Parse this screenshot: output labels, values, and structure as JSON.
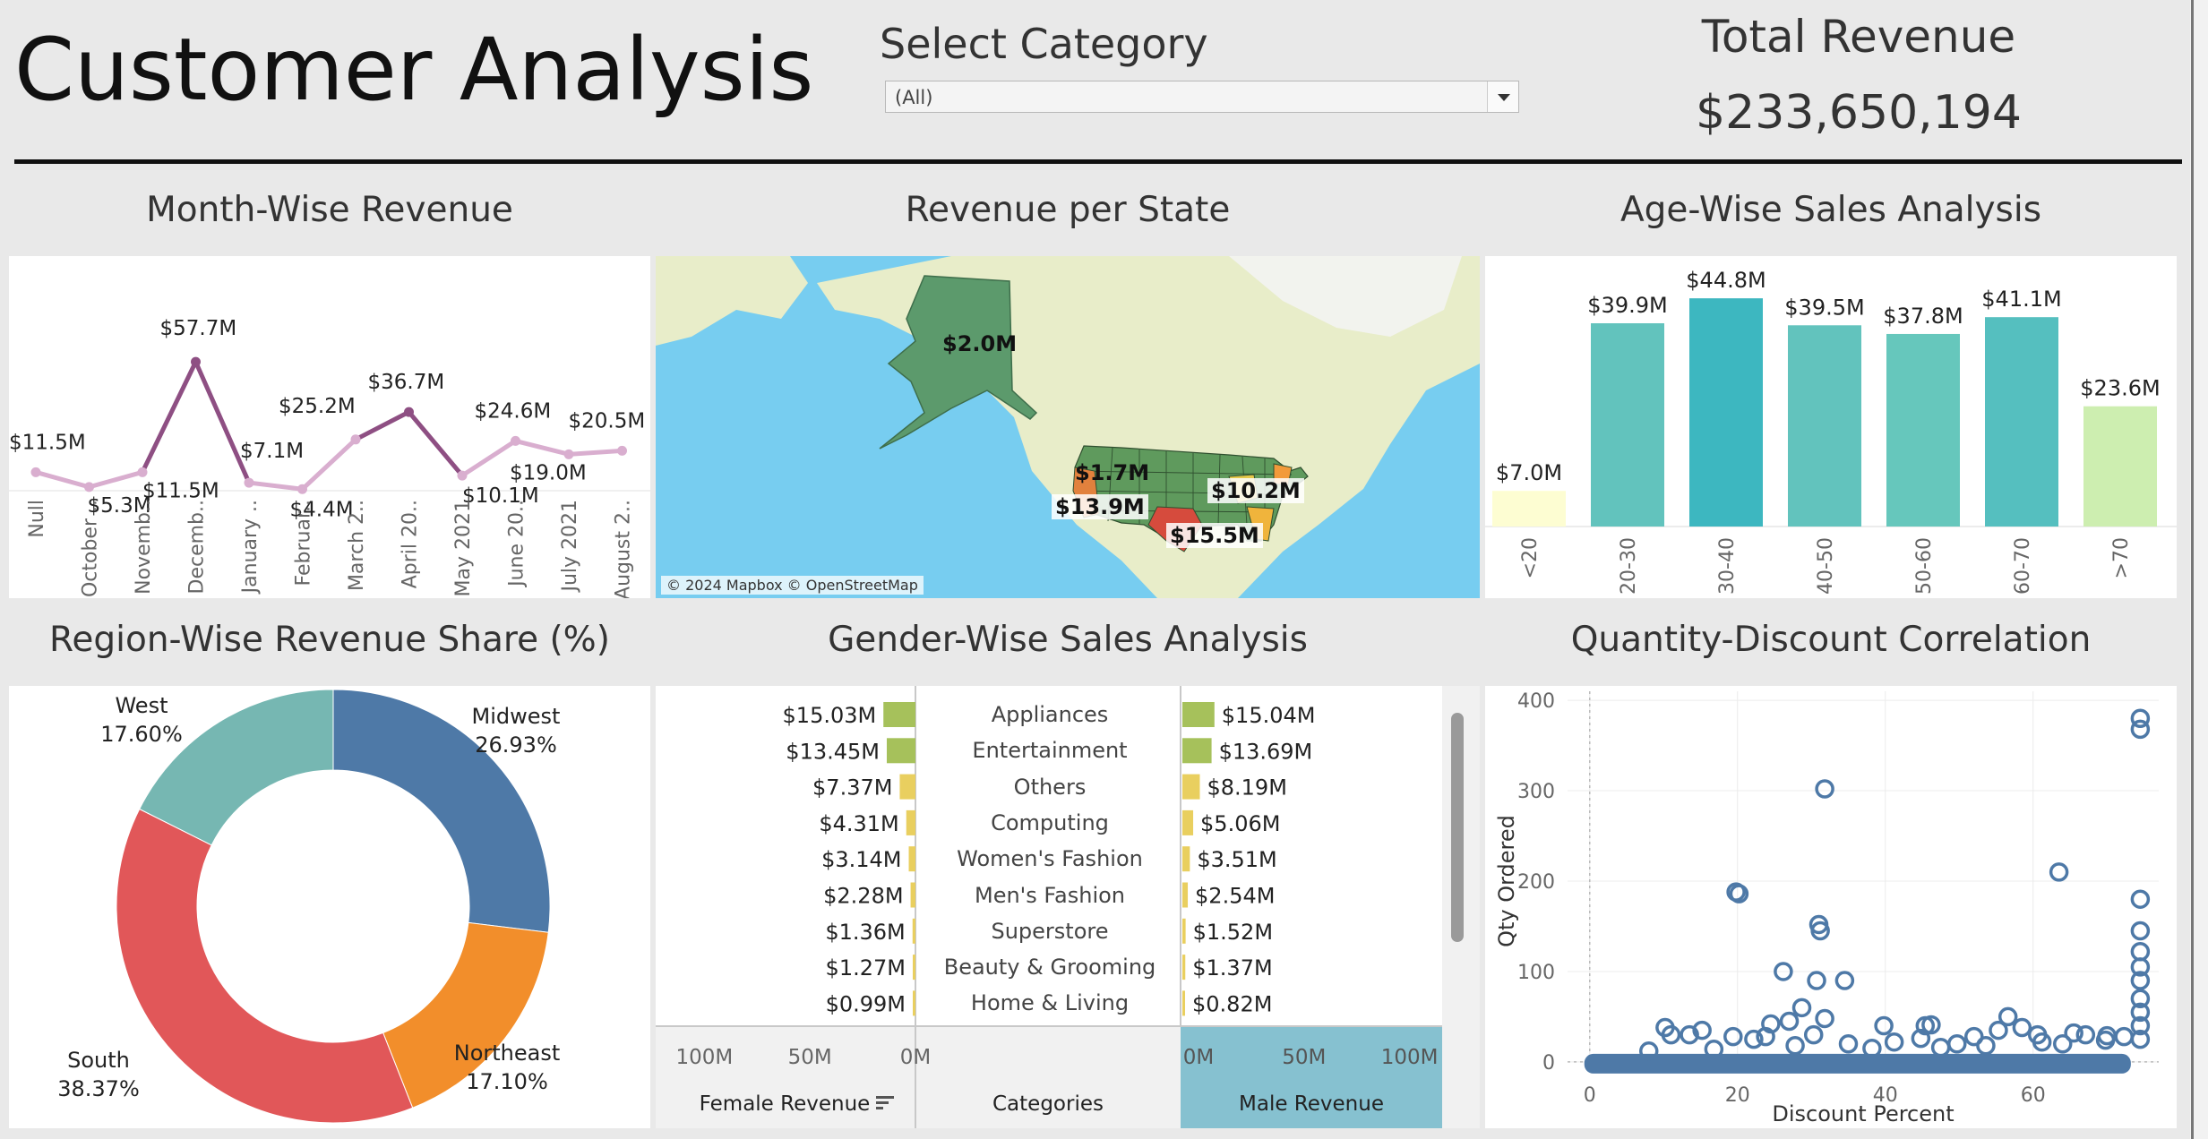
{
  "header": {
    "title": "Customer Analysis",
    "select_label": "Select Category",
    "select_value": "(All)",
    "revenue_label": "Total Revenue",
    "revenue_value": "$233,650,194"
  },
  "titles": {
    "month": "Month-Wise Revenue",
    "map": "Revenue per State",
    "age": "Age-Wise Sales Analysis",
    "region": "Region-Wise Revenue Share (%)",
    "gender": "Gender-Wise Sales Analysis",
    "scatter": "Quantity-Discount Correlation"
  },
  "map": {
    "credit": "© 2024 Mapbox © OpenStreetMap",
    "labels": [
      "$2.0M",
      "$1.7M",
      "$13.9M",
      "$15.5M",
      "$10.2M"
    ]
  },
  "chart_data": [
    {
      "id": "month",
      "type": "line",
      "title": "Month-Wise Revenue",
      "categories": [
        "Null",
        "October ..",
        "Novemb..",
        "Decemb..",
        "January ..",
        "Februar..",
        "March 2..",
        "April 20..",
        "May 2021",
        "June 20..",
        "July 2021",
        "August 2.."
      ],
      "values": [
        11.5,
        5.3,
        11.5,
        57.7,
        7.1,
        4.4,
        25.2,
        36.7,
        10.1,
        24.6,
        19.0,
        20.5
      ],
      "labels": [
        "$11.5M",
        "$5.3M",
        "$11.5M",
        "$57.7M",
        "$7.1M",
        "$4.4M",
        "$25.2M",
        "$36.7M",
        "$10.1M",
        "$24.6M",
        "$19.0M",
        "$20.5M"
      ],
      "unit": "$M",
      "ylim": [
        0,
        60
      ],
      "colors": [
        "#d9aecf",
        "#8e4f83"
      ]
    },
    {
      "id": "age",
      "type": "bar",
      "title": "Age-Wise Sales Analysis",
      "categories": [
        "<20",
        "20-30",
        "30-40",
        "40-50",
        "50-60",
        "60-70",
        ">70"
      ],
      "values": [
        7.0,
        39.9,
        44.8,
        39.5,
        37.8,
        41.1,
        23.6
      ],
      "labels": [
        "$7.0M",
        "$39.9M",
        "$44.8M",
        "$39.5M",
        "$37.8M",
        "$41.1M",
        "$23.6M"
      ],
      "ylim": [
        0,
        45
      ],
      "colors": [
        "#fdfdd2",
        "#62c3bd",
        "#3db7c0",
        "#62c3bd",
        "#66c7bc",
        "#55bfbf",
        "#cdeeb0"
      ]
    },
    {
      "id": "region",
      "type": "pie",
      "title": "Region-Wise Revenue Share (%)",
      "categories": [
        "Midwest",
        "Northeast",
        "South",
        "West"
      ],
      "values": [
        26.93,
        17.1,
        38.37,
        17.6
      ],
      "labels": [
        "26.93%",
        "17.10%",
        "38.37%",
        "17.60%"
      ],
      "colors": [
        "#4e79a7",
        "#f28e2b",
        "#e15759",
        "#76b7b2"
      ]
    },
    {
      "id": "gender",
      "type": "bar",
      "title": "Gender-Wise Sales Analysis",
      "categories": [
        "Appliances",
        "Entertainment",
        "Others",
        "Computing",
        "Women's Fashion",
        "Men's Fashion",
        "Superstore",
        "Beauty & Grooming",
        "Home & Living"
      ],
      "series": [
        {
          "name": "Female Revenue",
          "values": [
            15.03,
            13.45,
            7.37,
            4.31,
            3.14,
            2.28,
            1.36,
            1.27,
            0.99
          ],
          "labels": [
            "$15.03M",
            "$13.45M",
            "$7.37M",
            "$4.31M",
            "$3.14M",
            "$2.28M",
            "$1.36M",
            "$1.27M",
            "$0.99M"
          ]
        },
        {
          "name": "Male Revenue",
          "values": [
            15.04,
            13.69,
            8.19,
            5.06,
            3.51,
            2.54,
            1.52,
            1.37,
            0.82
          ],
          "labels": [
            "$15.04M",
            "$13.69M",
            "$8.19M",
            "$5.06M",
            "$3.51M",
            "$2.54M",
            "$1.52M",
            "$1.37M",
            "$0.82M"
          ]
        }
      ],
      "column_headers": [
        "Female Revenue",
        "Categories",
        "Male Revenue"
      ],
      "female_ticks": [
        "100M",
        "50M",
        "0M"
      ],
      "male_ticks": [
        "0M",
        "50M",
        "100M"
      ],
      "xlim": [
        0,
        100
      ],
      "colors": [
        "#a6c15b",
        "#e9cf5f"
      ]
    },
    {
      "id": "scatter",
      "type": "scatter",
      "title": "Quantity-Discount Correlation",
      "xlabel": "Discount Percent",
      "ylabel": "Qty Ordered",
      "xlim": [
        -3,
        77
      ],
      "ylim": [
        -10,
        410
      ],
      "xticks": [
        0,
        20,
        40,
        60
      ],
      "yticks": [
        0,
        100,
        200,
        300,
        400
      ],
      "points": [
        [
          31.8,
          302
        ],
        [
          63.5,
          210
        ],
        [
          74.5,
          380
        ],
        [
          74.5,
          368
        ],
        [
          74.5,
          180
        ],
        [
          74.5,
          145
        ],
        [
          74.5,
          122
        ],
        [
          74.5,
          105
        ],
        [
          74.5,
          90
        ],
        [
          74.5,
          70
        ],
        [
          74.5,
          55
        ],
        [
          74.5,
          40
        ],
        [
          74.5,
          25
        ],
        [
          19.8,
          188
        ],
        [
          20.2,
          186
        ],
        [
          31.0,
          152
        ],
        [
          31.2,
          145
        ],
        [
          26.2,
          100
        ],
        [
          30.7,
          90
        ],
        [
          34.5,
          90
        ],
        [
          28.7,
          60
        ],
        [
          24.5,
          42
        ],
        [
          27.0,
          45
        ],
        [
          31.8,
          48
        ],
        [
          30.3,
          30
        ],
        [
          23.8,
          28
        ],
        [
          39.8,
          40
        ],
        [
          45.4,
          40
        ],
        [
          46.2,
          41
        ],
        [
          56.6,
          50
        ],
        [
          58.5,
          38
        ],
        [
          65.5,
          32
        ],
        [
          60.6,
          30
        ],
        [
          10.2,
          38
        ],
        [
          11.0,
          30
        ],
        [
          13.5,
          30
        ],
        [
          15.2,
          35
        ],
        [
          19.4,
          28
        ],
        [
          22.2,
          25
        ],
        [
          44.8,
          26
        ],
        [
          52.0,
          28
        ],
        [
          55.3,
          35
        ],
        [
          67.1,
          30
        ],
        [
          72.3,
          28
        ],
        [
          70.0,
          29
        ],
        [
          35.0,
          20
        ],
        [
          41.2,
          22
        ],
        [
          49.7,
          20
        ],
        [
          61.2,
          22
        ],
        [
          69.8,
          24
        ],
        [
          8.0,
          12
        ],
        [
          16.8,
          14
        ],
        [
          27.8,
          18
        ],
        [
          38.2,
          15
        ],
        [
          47.5,
          16
        ],
        [
          53.6,
          18
        ],
        [
          64.0,
          20
        ]
      ],
      "point_color": "#4e79a7"
    }
  ]
}
